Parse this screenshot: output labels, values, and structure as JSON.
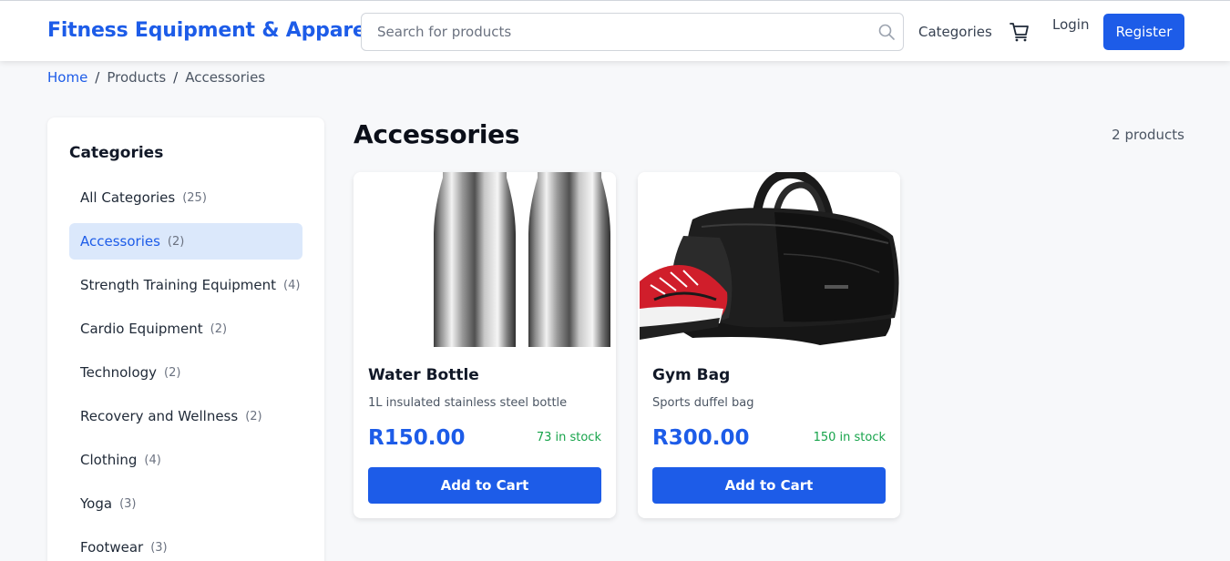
{
  "header": {
    "brand": "Fitness Equipment & Apparel",
    "search_placeholder": "Search for products",
    "categories_label": "Categories",
    "login_label": "Login",
    "register_label": "Register",
    "icons": [
      "search-icon",
      "cart-icon"
    ]
  },
  "breadcrumb": {
    "items": [
      "Home",
      "Products",
      "Accessories"
    ],
    "separator": "/"
  },
  "sidebar": {
    "title": "Categories",
    "items": [
      {
        "label": "All Categories",
        "count": "(25)",
        "active": false
      },
      {
        "label": "Accessories",
        "count": "(2)",
        "active": true
      },
      {
        "label": "Strength Training Equipment",
        "count": "(4)",
        "active": false
      },
      {
        "label": "Cardio Equipment",
        "count": "(2)",
        "active": false
      },
      {
        "label": "Technology",
        "count": "(2)",
        "active": false
      },
      {
        "label": "Recovery and Wellness",
        "count": "(2)",
        "active": false
      },
      {
        "label": "Clothing",
        "count": "(4)",
        "active": false
      },
      {
        "label": "Yoga",
        "count": "(3)",
        "active": false
      },
      {
        "label": "Footwear",
        "count": "(3)",
        "active": false
      }
    ]
  },
  "main": {
    "title": "Accessories",
    "product_count": "2 products",
    "products": [
      {
        "name": "Water Bottle",
        "description": "1L insulated stainless steel bottle",
        "price": "R150.00",
        "stock": "73 in stock",
        "button_label": "Add to Cart"
      },
      {
        "name": "Gym Bag",
        "description": "Sports duffel bag",
        "price": "R300.00",
        "stock": "150 in stock",
        "button_label": "Add to Cart"
      }
    ]
  },
  "colors": {
    "accent": "#1d5ce8",
    "stock_green": "#16a34a",
    "active_bg": "#dbe8fb",
    "page_bg": "#f7f8fa"
  }
}
